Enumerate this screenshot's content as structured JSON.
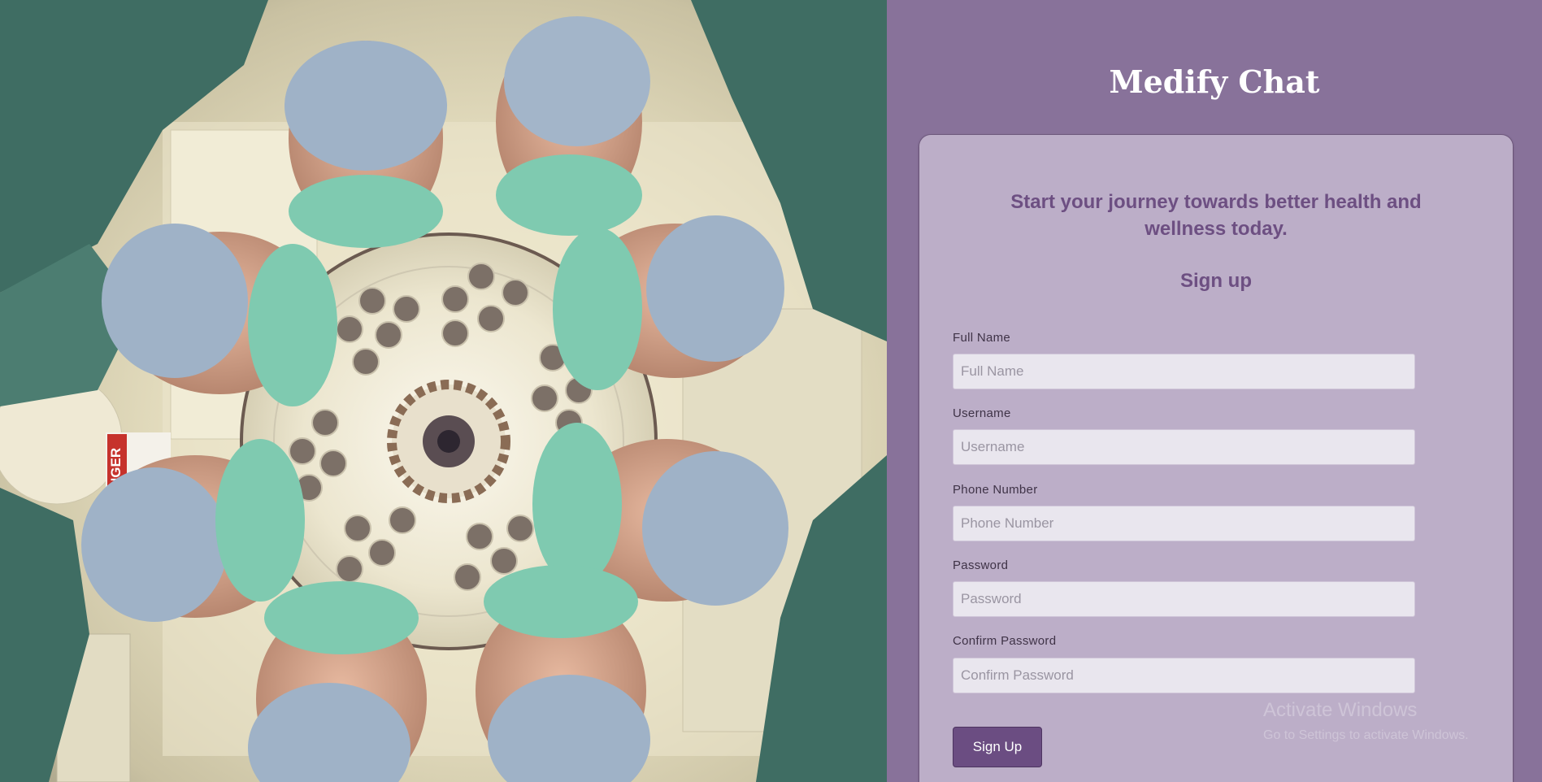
{
  "photo": {
    "alt_icon": "surgeons-team-photo",
    "danger_sign": "NGER"
  },
  "brand": {
    "title": "Medify Chat"
  },
  "card": {
    "tagline": "Start your journey towards better health and wellness today.",
    "heading": "Sign up"
  },
  "form": {
    "full_name": {
      "label": "Full Name",
      "placeholder": "Full Name",
      "value": ""
    },
    "username": {
      "label": "Username",
      "placeholder": "Username",
      "value": ""
    },
    "phone": {
      "label": "Phone Number",
      "placeholder": "Phone Number",
      "value": ""
    },
    "password": {
      "label": "Password",
      "placeholder": "Password",
      "value": ""
    },
    "confirm_password": {
      "label": "Confirm Password",
      "placeholder": "Confirm Password",
      "value": ""
    },
    "submit_label": "Sign Up"
  },
  "watermark": {
    "line1": "Activate Windows",
    "line2": "Go to Settings to activate Windows."
  },
  "colors": {
    "panel_bg": "#88729a",
    "card_bg": "#bcaec8",
    "accent": "#6d4f82",
    "button_bg": "#6b4d82"
  }
}
